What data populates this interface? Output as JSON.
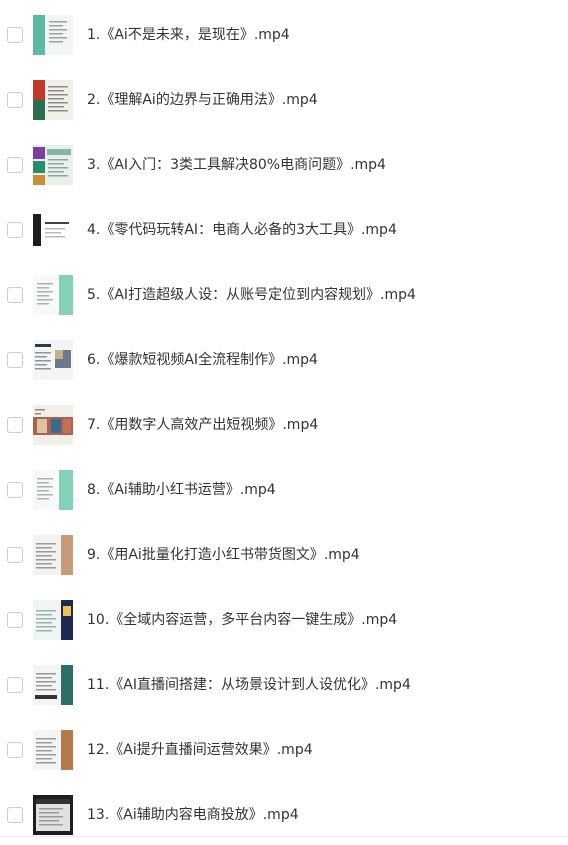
{
  "files": [
    {
      "name": "1.《Ai不是未来，是现在》.mp4",
      "thumb": {
        "bg": "#f3f4f4",
        "accent": "#3fae95",
        "variant": "side-bar"
      }
    },
    {
      "name": "2.《理解Ai的边界与正确用法》.mp4",
      "thumb": {
        "bg": "#f2efe8",
        "accent": "#c0392b",
        "variant": "stacked-photos"
      }
    },
    {
      "name": "3.《AI入门：3类工具解决80%电商问题》.mp4",
      "thumb": {
        "bg": "#e9f0ec",
        "accent": "#7b3fa0",
        "variant": "grid-photos"
      }
    },
    {
      "name": "4.《零代码玩转AI：电商人必备的3大工具》.mp4",
      "thumb": {
        "bg": "#ffffff",
        "accent": "#1d1d1d",
        "variant": "dark-strip"
      }
    },
    {
      "name": "5.《AI打造超级人设：从账号定位到内容规划》.mp4",
      "thumb": {
        "bg": "#f7f8f8",
        "accent": "#5cc4a4",
        "variant": "right-gradient"
      }
    },
    {
      "name": "6.《爆款短视频AI全流程制作》.mp4",
      "thumb": {
        "bg": "#f3f4f4",
        "accent": "#2f3a44",
        "variant": "slide-photos"
      }
    },
    {
      "name": "7.《用数字人高效产出短视频》.mp4",
      "thumb": {
        "bg": "#f1efe9",
        "accent": "#9b4a3a",
        "variant": "wide-photos"
      }
    },
    {
      "name": "8.《Ai辅助小红书运营》.mp4",
      "thumb": {
        "bg": "#f7f8f8",
        "accent": "#5cc4a4",
        "variant": "right-gradient"
      }
    },
    {
      "name": "9.《用Ai批量化打造小红书带货图文》.mp4",
      "thumb": {
        "bg": "#f2f2f0",
        "accent": "#c79a78",
        "variant": "side-photo"
      }
    },
    {
      "name": "10.《全域内容运营，多平台内容一键生成》.mp4",
      "thumb": {
        "bg": "#eef5f2",
        "accent": "#1e2a55",
        "variant": "right-poster"
      }
    },
    {
      "name": "11.《AI直播间搭建：从场景设计到人设优化》.mp4",
      "thumb": {
        "bg": "#f3f4f4",
        "accent": "#2f6f6a",
        "variant": "side-photo-dark"
      }
    },
    {
      "name": "12.《Ai提升直播间运营效果》.mp4",
      "thumb": {
        "bg": "#f3f4f4",
        "accent": "#b57a48",
        "variant": "side-photo"
      }
    },
    {
      "name": "13.《Ai辅助内容电商投放》.mp4",
      "thumb": {
        "bg": "#1e1e1e",
        "accent": "#f2f2f2",
        "variant": "dark-slide"
      }
    }
  ]
}
